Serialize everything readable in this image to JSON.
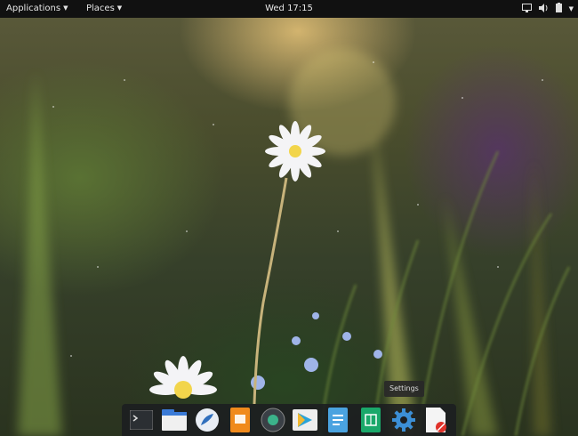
{
  "topbar": {
    "applications_label": "Applications",
    "places_label": "Places",
    "clock": "Wed 17:15",
    "indicators": [
      "display-icon",
      "volume-icon",
      "battery-icon",
      "system-menu-caret-icon"
    ]
  },
  "dock": {
    "items": [
      {
        "icon": "terminal-icon"
      },
      {
        "icon": "files-icon"
      },
      {
        "icon": "web-browser-icon"
      },
      {
        "icon": "presentation-icon"
      },
      {
        "icon": "media-player-icon"
      },
      {
        "icon": "app-store-icon"
      },
      {
        "icon": "document-viewer-icon"
      },
      {
        "icon": "spreadsheet-icon"
      },
      {
        "icon": "settings-icon"
      },
      {
        "icon": "document-blocked-icon"
      }
    ],
    "tooltip": "Settings"
  },
  "colors": {
    "topbar_bg": "#111111",
    "dock_bg": "#1c1e20",
    "settings_blue": "#3c8fd6"
  }
}
